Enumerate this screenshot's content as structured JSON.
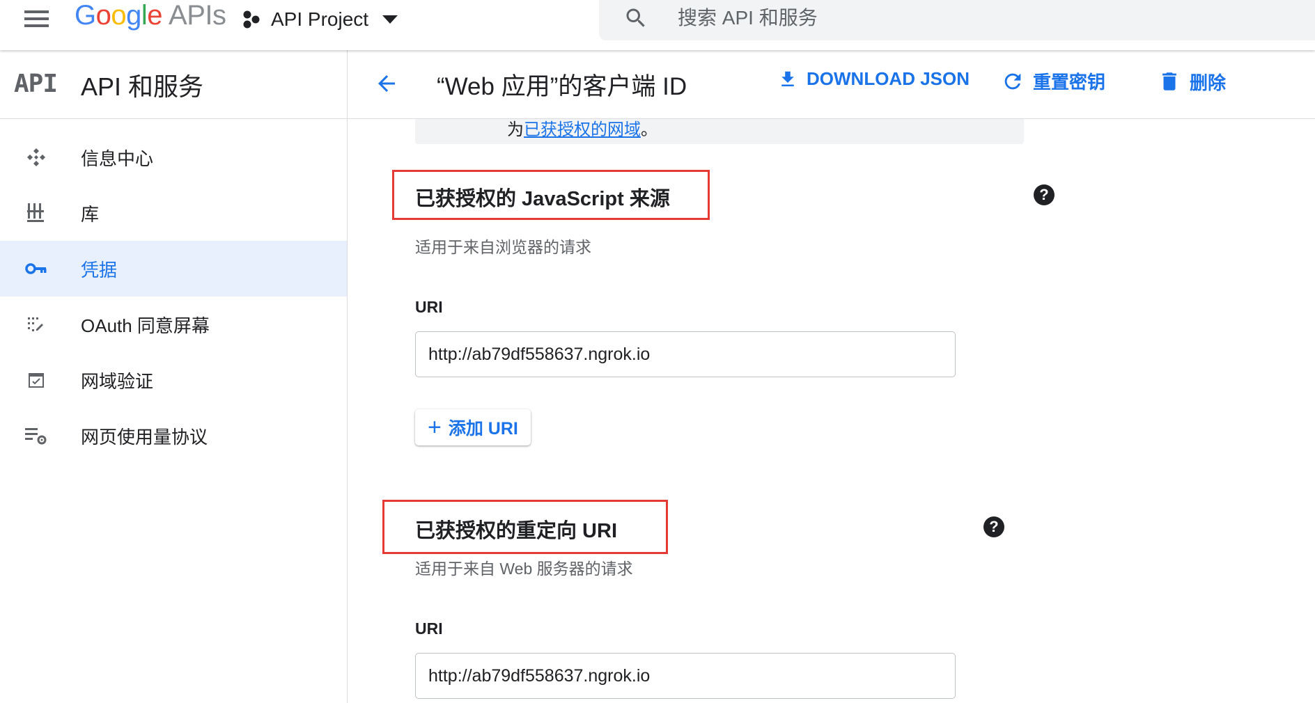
{
  "topbar": {
    "logo_google": "Google",
    "logo_apis": "APIs",
    "project_name": "API Project",
    "search_placeholder": "搜索 API 和服务"
  },
  "sidebar": {
    "icon_text": "API",
    "title": "API 和服务",
    "items": [
      {
        "label": "信息中心",
        "icon": "dashboard-icon"
      },
      {
        "label": "库",
        "icon": "library-icon"
      },
      {
        "label": "凭据",
        "icon": "key-icon",
        "active": true
      },
      {
        "label": "OAuth 同意屏幕",
        "icon": "consent-screen-icon"
      },
      {
        "label": "网域验证",
        "icon": "domain-verification-icon"
      },
      {
        "label": "网页使用量协议",
        "icon": "usage-agreement-icon"
      }
    ]
  },
  "header": {
    "title": "“Web 应用”的客户端 ID",
    "download_label": "DOWNLOAD JSON",
    "reset_label": "重置密钥",
    "delete_label": "删除"
  },
  "info": {
    "prefix": "为",
    "link": "已获授权的网域",
    "suffix": "。"
  },
  "js_origins": {
    "title": "已获授权的 JavaScript 来源",
    "help": "?",
    "description": "适用于来自浏览器的请求",
    "uri_label": "URI",
    "uri_value": "http://ab79df558637.ngrok.io",
    "add_button": "添加 URI",
    "add_plus": "+"
  },
  "redirect_uris": {
    "title": "已获授权的重定向 URI",
    "help": "?",
    "description": "适用于来自 Web 服务器的请求",
    "uri_label": "URI",
    "uri_value": "http://ab79df558637.ngrok.io"
  },
  "colors": {
    "accent": "#1a73e8",
    "highlight_box": "#e53935",
    "active_bg": "#e8f0fe"
  }
}
